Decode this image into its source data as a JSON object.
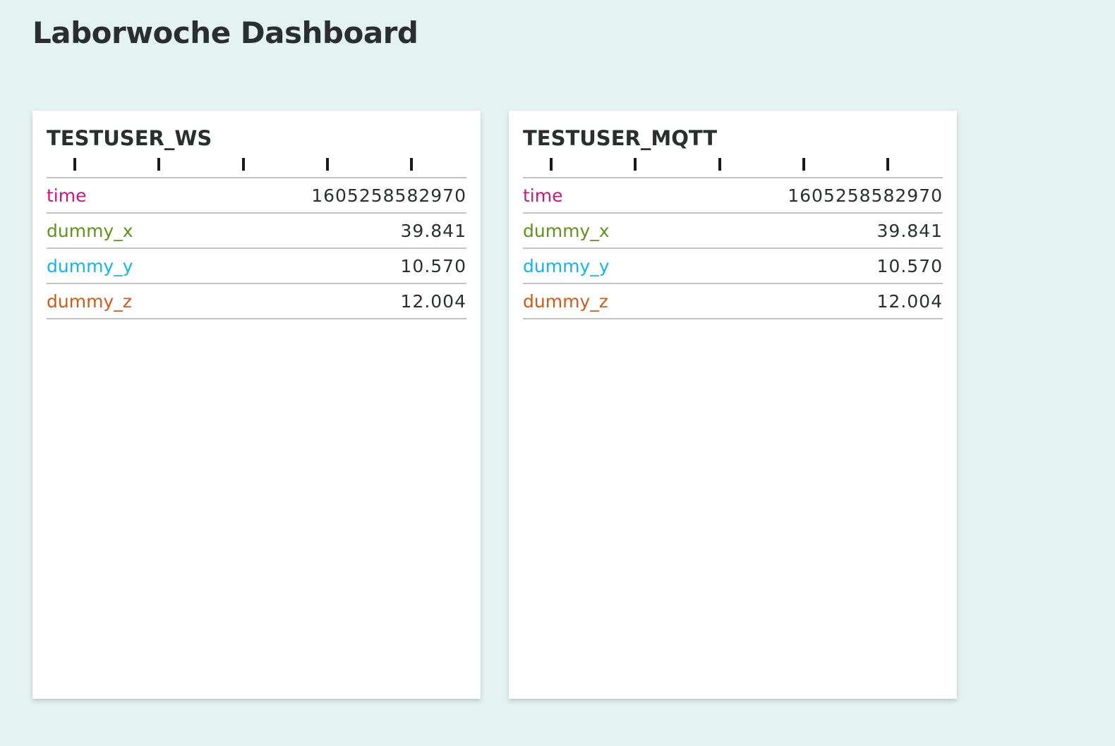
{
  "page": {
    "title": "Laborwoche Dashboard"
  },
  "cards": [
    {
      "title": "TESTUSER_WS",
      "rows": [
        {
          "label": "time",
          "value": "1605258582970",
          "color": "#c8177f"
        },
        {
          "label": "dummy_x",
          "value": "39.841",
          "color": "#5e9419"
        },
        {
          "label": "dummy_y",
          "value": "10.570",
          "color": "#13b4e8"
        },
        {
          "label": "dummy_z",
          "value": "12.004",
          "color": "#cf5a16"
        }
      ]
    },
    {
      "title": "TESTUSER_MQTT",
      "rows": [
        {
          "label": "time",
          "value": "1605258582970",
          "color": "#c8177f"
        },
        {
          "label": "dummy_x",
          "value": "39.841",
          "color": "#5e9419"
        },
        {
          "label": "dummy_y",
          "value": "10.570",
          "color": "#13b4e8"
        },
        {
          "label": "dummy_z",
          "value": "12.004",
          "color": "#cf5a16"
        }
      ]
    }
  ]
}
